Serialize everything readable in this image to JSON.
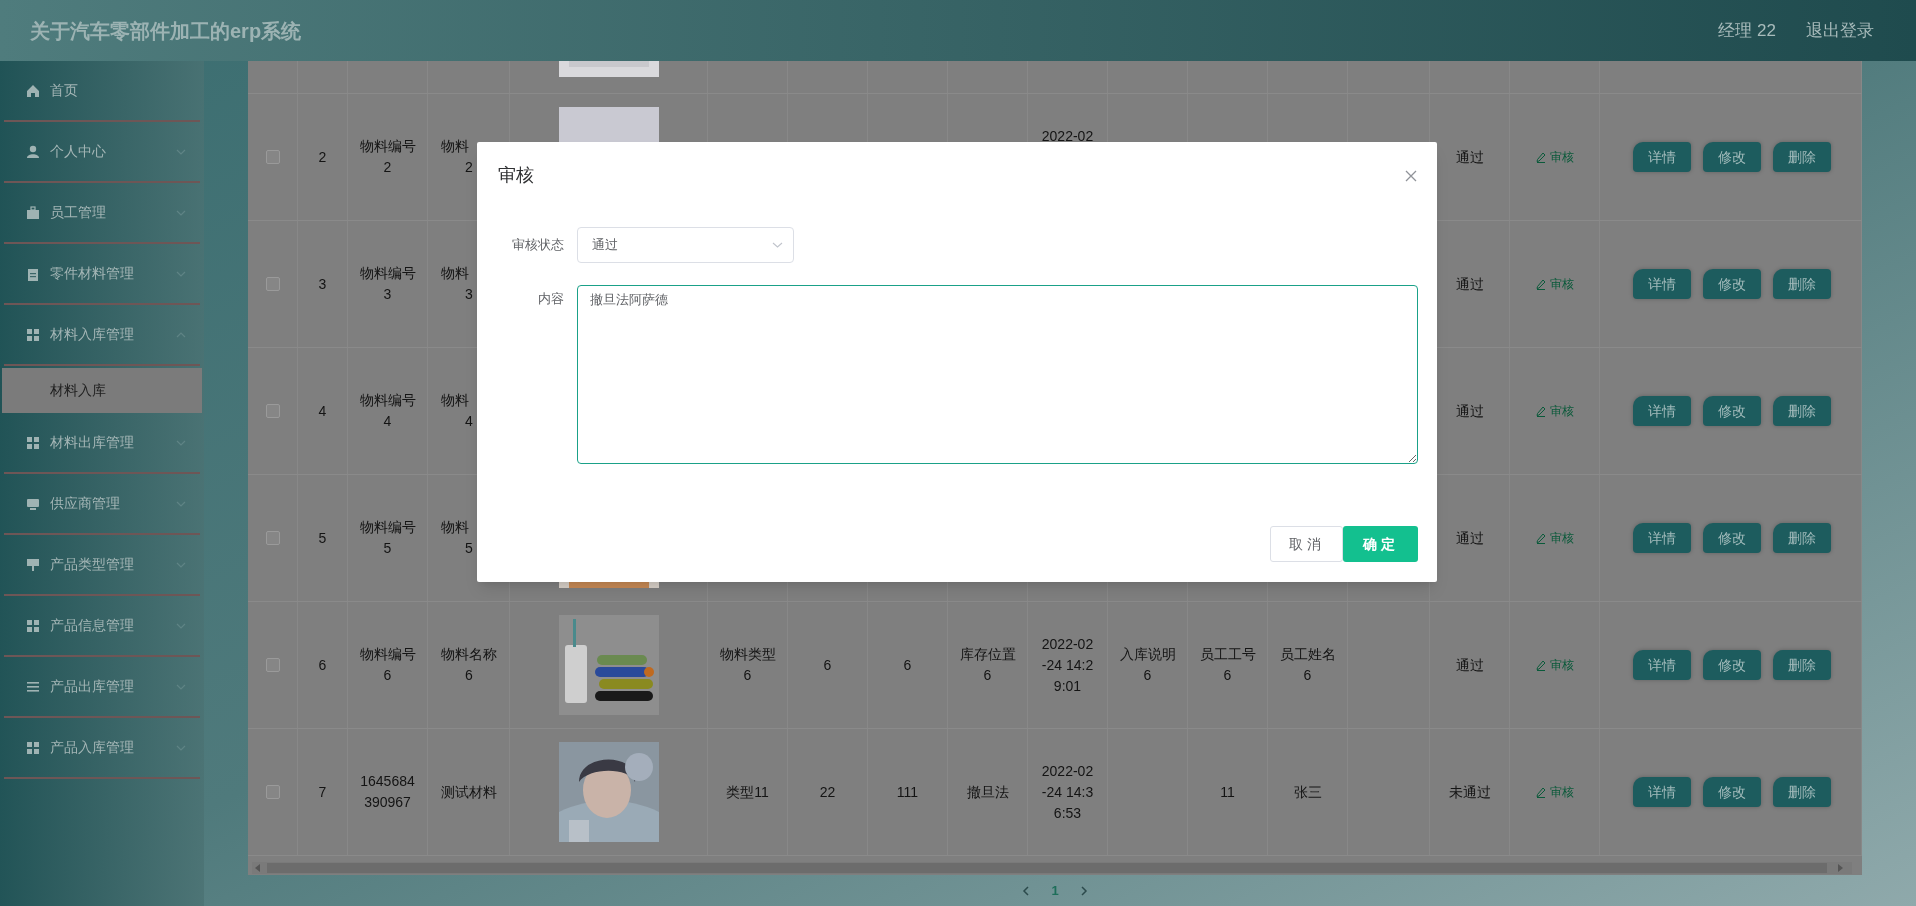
{
  "header": {
    "title": "关于汽车零部件加工的erp系统",
    "user": "经理 22",
    "logout": "退出登录"
  },
  "sidebar": {
    "items": [
      {
        "label": "首页",
        "selected": false
      },
      {
        "label": "个人中心",
        "expanded": false,
        "selected": false
      },
      {
        "label": "员工管理",
        "expanded": false,
        "selected": false
      },
      {
        "label": "零件材料管理",
        "expanded": false,
        "selected": false
      },
      {
        "label": "材料入库管理",
        "expanded": true,
        "selected": false,
        "children": [
          {
            "label": "材料入库",
            "selected": true
          }
        ]
      },
      {
        "label": "材料出库管理",
        "expanded": false,
        "selected": false
      },
      {
        "label": "供应商管理",
        "expanded": false,
        "selected": false
      },
      {
        "label": "产品类型管理",
        "expanded": false,
        "selected": false
      },
      {
        "label": "产品信息管理",
        "expanded": false,
        "selected": false
      },
      {
        "label": "产品出库管理",
        "expanded": false,
        "selected": false
      },
      {
        "label": "产品入库管理",
        "expanded": false,
        "selected": false
      }
    ]
  },
  "table": {
    "rows": [
      {
        "image": {
          "kind": "picture"
        }
      },
      {
        "checked": false,
        "index": "2",
        "code": "物料编号\n2",
        "name": "物料\n2",
        "image": {
          "kind": "picture"
        },
        "date": "2022-02",
        "status": "通过",
        "review": "审核",
        "actions": [
          "详情",
          "修改",
          "删除"
        ]
      },
      {
        "checked": false,
        "index": "3",
        "code": "物料编号\n3",
        "name": "物料\n3",
        "status": "通过",
        "review": "审核",
        "actions": [
          "详情",
          "修改",
          "删除"
        ]
      },
      {
        "checked": false,
        "index": "4",
        "code": "物料编号\n4",
        "name": "物料\n4",
        "status": "通过",
        "review": "审核",
        "actions": [
          "详情",
          "修改",
          "删除"
        ]
      },
      {
        "checked": false,
        "index": "5",
        "code": "物料编号\n5",
        "name": "物料\n5",
        "image": {
          "kind": "picture"
        },
        "status": "通过",
        "review": "审核",
        "actions": [
          "详情",
          "修改",
          "删除"
        ]
      },
      {
        "checked": false,
        "index": "6",
        "code": "物料编号\n6",
        "name": "物料名称\n6",
        "image": {
          "kind": "picture"
        },
        "type": "物料类型\n6",
        "qty": "6",
        "stock": "6",
        "location": "库存位置\n6",
        "date": "2022-02\n-24 14:2\n9:01",
        "note": "入库说明\n6",
        "emp_no": "员工工号\n6",
        "emp_name": "员工姓名\n6",
        "status": "通过",
        "review": "审核",
        "actions": [
          "详情",
          "修改",
          "删除"
        ]
      },
      {
        "checked": false,
        "index": "7",
        "code": "1645684\n390967",
        "name": "测试材料",
        "image": {
          "kind": "picture"
        },
        "type": "类型11",
        "qty": "22",
        "stock": "111",
        "location": "撤旦法",
        "date": "2022-02\n-24 14:3\n6:53",
        "emp_no": "11",
        "emp_name": "张三",
        "status": "未通过",
        "review": "审核",
        "actions": [
          "详情",
          "修改",
          "删除"
        ]
      }
    ]
  },
  "pagination": {
    "pages": [
      {
        "label": "1",
        "selected": true
      }
    ]
  },
  "dialog": {
    "title": "审核",
    "fields": [
      {
        "kind": "select",
        "label": "审核状态",
        "value": "通过"
      },
      {
        "kind": "textarea",
        "label": "内容",
        "value": "撤旦法阿萨德"
      }
    ],
    "buttons": [
      {
        "kind": "default",
        "label": "取消"
      },
      {
        "kind": "primary",
        "label": "确定"
      }
    ]
  }
}
